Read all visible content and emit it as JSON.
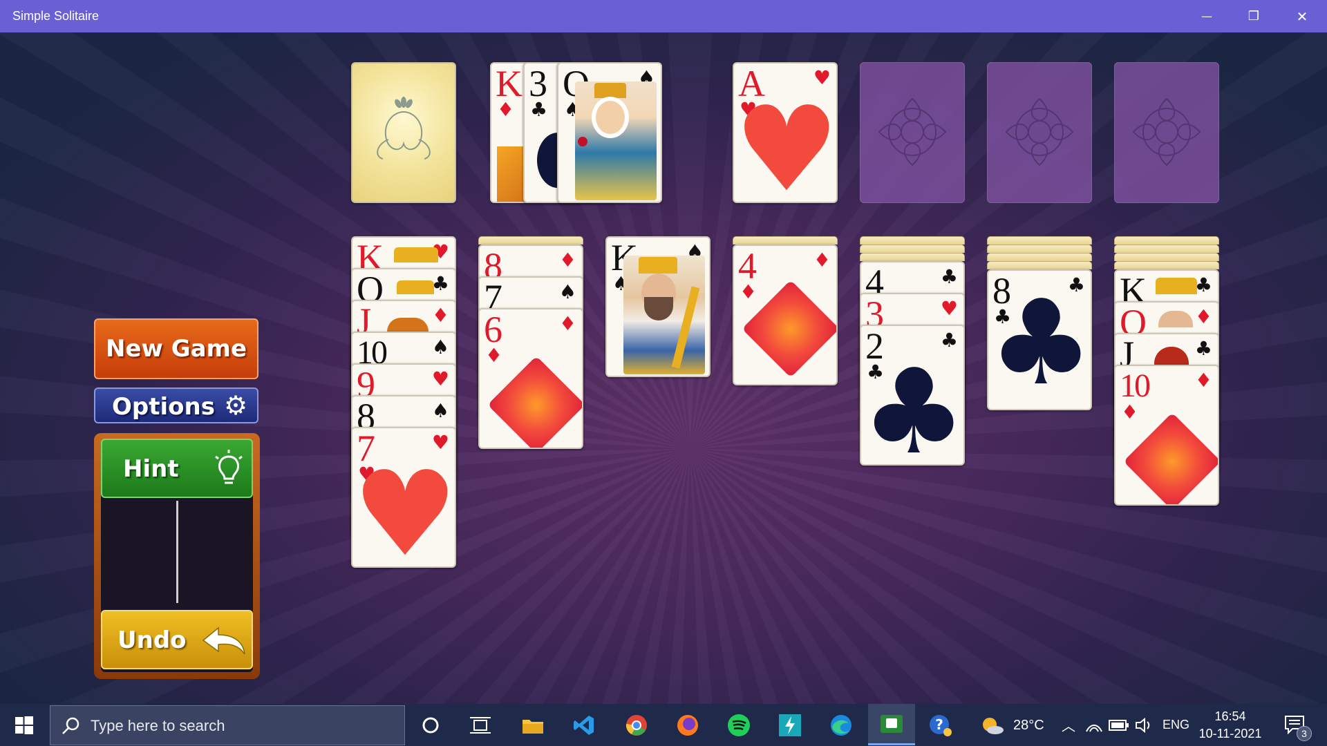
{
  "window": {
    "title": "Simple Solitaire",
    "minimize_glyph": "—",
    "restore_glyph": "❐",
    "close_glyph": "✕"
  },
  "sidebar": {
    "new_game_label": "New Game",
    "options_label": "Options",
    "hint_label": "Hint",
    "undo_label": "Undo"
  },
  "cards": {
    "waste": [
      {
        "rank": "K",
        "suit": "♦"
      },
      {
        "rank": "3",
        "suit": "♣"
      },
      {
        "rank": "Q",
        "suit": "♠"
      }
    ],
    "foundation_1": {
      "rank": "A",
      "suit": "♥"
    },
    "tableau_1": [
      {
        "rank": "K",
        "suit": "♥"
      },
      {
        "rank": "Q",
        "suit": "♣"
      },
      {
        "rank": "J",
        "suit": "♦"
      },
      {
        "rank": "10",
        "suit": "♠"
      },
      {
        "rank": "9",
        "suit": "♥"
      },
      {
        "rank": "8",
        "suit": "♠"
      },
      {
        "rank": "7",
        "suit": "♥"
      }
    ],
    "tableau_2": [
      {
        "rank": "8",
        "suit": "♦"
      },
      {
        "rank": "7",
        "suit": "♠"
      },
      {
        "rank": "6",
        "suit": "♦"
      }
    ],
    "tableau_3": [
      {
        "rank": "K",
        "suit": "♠"
      }
    ],
    "tableau_4": [
      {
        "rank": "4",
        "suit": "♦"
      }
    ],
    "tableau_5": [
      {
        "rank": "4",
        "suit": "♣"
      },
      {
        "rank": "3",
        "suit": "♥"
      },
      {
        "rank": "2",
        "suit": "♣"
      }
    ],
    "tableau_6": [
      {
        "rank": "8",
        "suit": "♣"
      }
    ],
    "tableau_7": [
      {
        "rank": "K",
        "suit": "♣"
      },
      {
        "rank": "Q",
        "suit": "♦"
      },
      {
        "rank": "J",
        "suit": "♣"
      },
      {
        "rank": "10",
        "suit": "♦"
      }
    ]
  },
  "taskbar": {
    "search_placeholder": "Type here to search",
    "temperature": "28°C",
    "language": "ENG",
    "time": "16:54",
    "date": "10-11-2021",
    "notification_count": "3"
  },
  "colors": {
    "titlebar": "#6a60d6",
    "new_game": "#d4510e",
    "options": "#2a3a8e",
    "hint": "#2a9a2a",
    "undo": "#e0a812",
    "taskbar": "#1f2a4a"
  }
}
